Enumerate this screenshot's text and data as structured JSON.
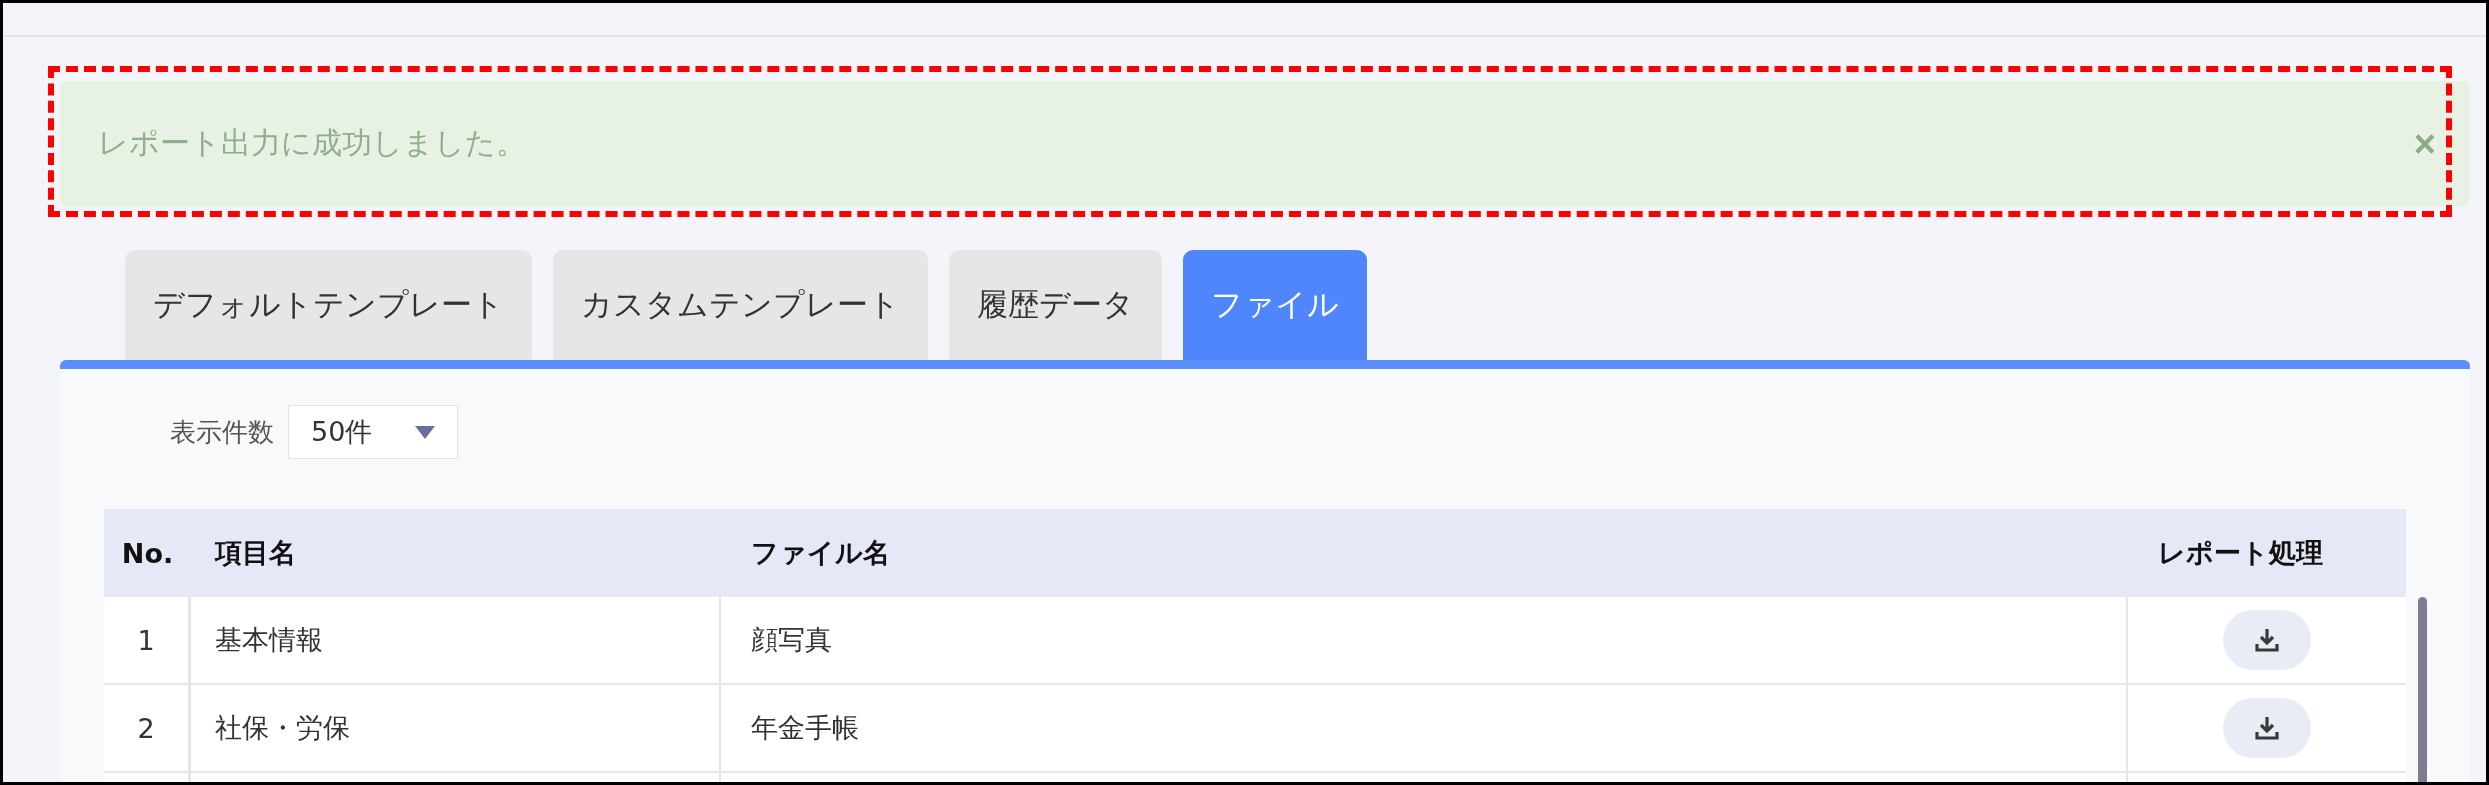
{
  "alert": {
    "message": "レポート出力に成功しました。",
    "close": "×"
  },
  "tabs": [
    {
      "label": "デフォルトテンプレート",
      "selected": false
    },
    {
      "label": "カスタムテンプレート",
      "selected": false
    },
    {
      "label": "履歴データ",
      "selected": false
    },
    {
      "label": "ファイル",
      "selected": true
    }
  ],
  "page_size": {
    "label": "表示件数",
    "value": "50件"
  },
  "table": {
    "columns": [
      "No.",
      "項目名",
      "ファイル名",
      "レポート処理"
    ],
    "rows": [
      {
        "no": "1",
        "item": "基本情報",
        "file": "顔写真"
      },
      {
        "no": "2",
        "item": "社保・労保",
        "file": "年金手帳"
      }
    ]
  }
}
